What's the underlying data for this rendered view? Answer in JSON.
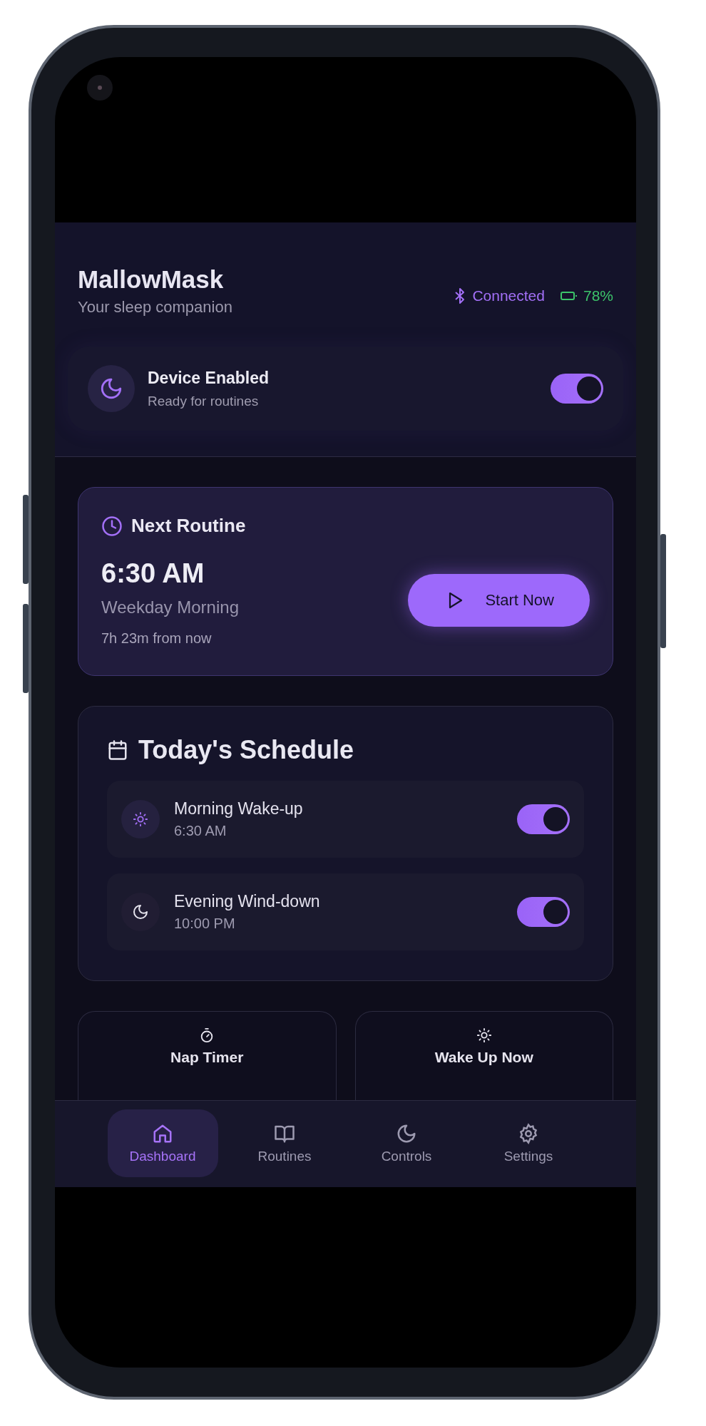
{
  "app": {
    "title": "MallowMask",
    "subtitle": "Your sleep companion"
  },
  "status": {
    "connection": "Connected",
    "battery": "78%"
  },
  "device": {
    "title": "Device Enabled",
    "subtitle": "Ready for routines",
    "on": true
  },
  "next_routine": {
    "heading": "Next Routine",
    "time": "6:30 AM",
    "name": "Weekday Morning",
    "countdown": "7h 23m from now",
    "button": "Start Now"
  },
  "schedule": {
    "heading": "Today's Schedule",
    "items": [
      {
        "kind": "morning",
        "name": "Morning Wake-up",
        "time": "6:30 AM",
        "on": true
      },
      {
        "kind": "evening",
        "name": "Evening Wind-down",
        "time": "10:00 PM",
        "on": true
      }
    ]
  },
  "quick_actions": [
    {
      "label": "Nap Timer"
    },
    {
      "label": "Wake Up Now"
    }
  ],
  "nav": [
    {
      "label": "Dashboard",
      "selected": true
    },
    {
      "label": "Routines",
      "selected": false
    },
    {
      "label": "Controls",
      "selected": false
    },
    {
      "label": "Settings",
      "selected": false
    }
  ]
}
